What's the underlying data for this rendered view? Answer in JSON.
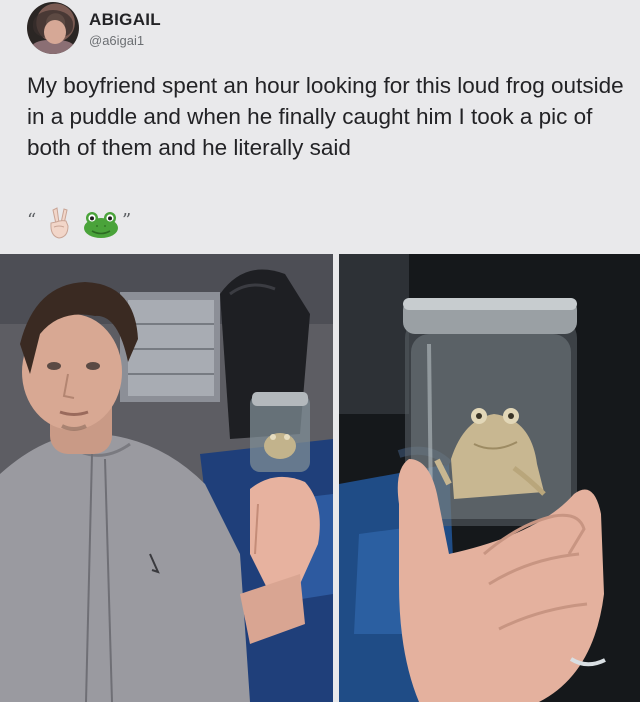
{
  "tweet": {
    "author_name": "ABIGAIL",
    "author_handle": "@a6igai1",
    "text": "My boyfriend spent an hour looking for this loud frog outside in a puddle and when he finally caught him I took a pic of both of them and he literally said",
    "quote_open": "“",
    "quote_close": "”",
    "emojis": [
      "victory-hand-icon",
      "frog-face-icon"
    ]
  },
  "photos": [
    {
      "subject": "man-holding-frog-jar-photo"
    },
    {
      "subject": "frog-jar-closeup-photo"
    }
  ],
  "colors": {
    "background": "#e9e9eb",
    "text": "#232326",
    "handle": "#6c6f73",
    "frog_green": "#4aa33a"
  }
}
